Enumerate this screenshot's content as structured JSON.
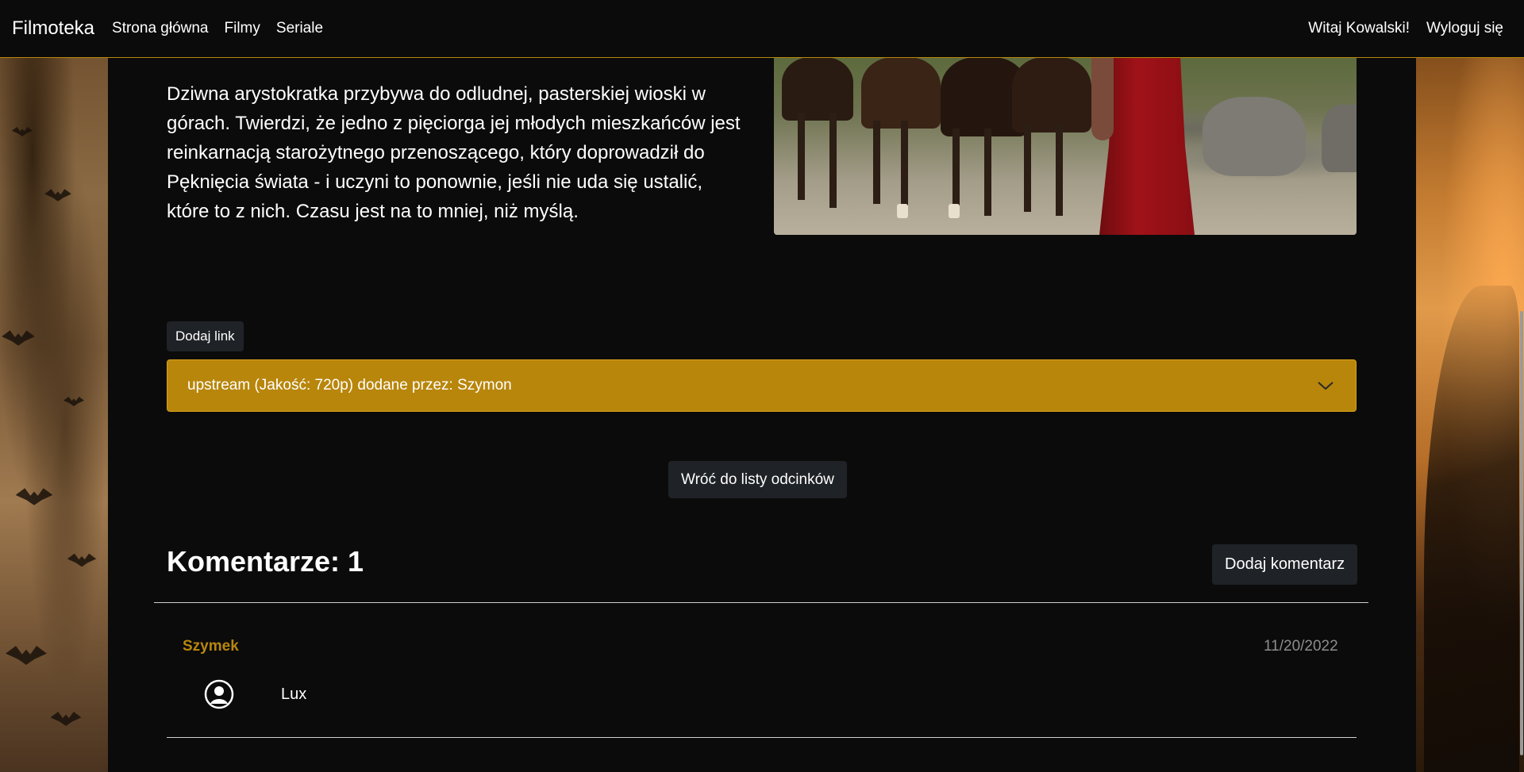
{
  "navbar": {
    "brand": "Filmoteka",
    "links": [
      "Strona główna",
      "Filmy",
      "Seriale"
    ],
    "greeting": "Witaj Kowalski!",
    "logout": "Wyloguj się"
  },
  "episode": {
    "description": "Dziwna arystokratka przybywa do odludnej, pasterskiej wioski w górach. Twierdzi, że jedno z pięciorga jej młodych mieszkańców jest reinkarnacją starożytnego przenoszącego, który doprowadził do Pęknięcia świata - i uczyni to ponownie, jeśli nie uda się ustalić, które to z nich. Czasu jest na to mniej, niż myślą."
  },
  "links": {
    "add_label": "Dodaj link",
    "items": [
      {
        "label": "upstream (Jakość: 720p) dodane przez: Szymon"
      }
    ]
  },
  "back_label": "Wróć do listy odcinków",
  "comments": {
    "title": "Komentarze: 1",
    "add_label": "Dodaj komentarz",
    "items": [
      {
        "author": "Szymek",
        "date": "11/20/2022",
        "text": "Lux"
      }
    ]
  },
  "colors": {
    "accent": "#b8860b",
    "background": "#0b0b0b",
    "button": "#1f2226"
  },
  "icons": {
    "accordion": "chevron-down-icon",
    "avatar": "user-circle-icon"
  }
}
